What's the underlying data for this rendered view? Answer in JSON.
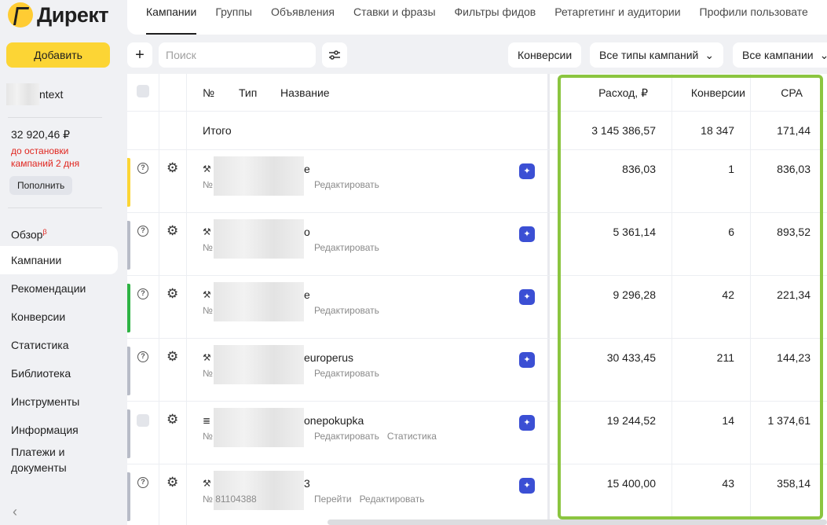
{
  "app": {
    "logo_text": "Директ"
  },
  "sidebar": {
    "add_label": "Добавить",
    "account_suffix": "ntext",
    "balance": "32 920,46 ₽",
    "warning": "до остановки кампаний 2 дня",
    "topup_label": "Пополнить",
    "items": [
      {
        "label": "Обзор",
        "sup": "β"
      },
      {
        "label": "Кампании"
      },
      {
        "label": "Рекомендации"
      },
      {
        "label": "Конверсии"
      },
      {
        "label": "Статистика"
      },
      {
        "label": "Библиотека"
      },
      {
        "label": "Инструменты"
      },
      {
        "label": "Информация"
      },
      {
        "label": "Платежи и документы"
      }
    ],
    "collapse_glyph": "‹"
  },
  "tabs": [
    "Кампании",
    "Группы",
    "Объявления",
    "Ставки и фразы",
    "Фильтры фидов",
    "Ретаргетинг и аудитории",
    "Профили пользовате"
  ],
  "toolbar": {
    "add_glyph": "+",
    "search_placeholder": "Поиск",
    "filter_conversions": "Конверсии",
    "filter_types": "Все типы кампаний",
    "filter_all": "Все кампании"
  },
  "table": {
    "headers": {
      "num": "№",
      "type": "Тип",
      "name": "Название",
      "spend": "Расход, ₽",
      "conversions": "Конверсии",
      "cpa": "CPA"
    },
    "total": {
      "label": "Итого",
      "spend": "3 145 386,57",
      "conversions": "18 347",
      "cpa": "171,44"
    },
    "rows": [
      {
        "status_color": "#fcd535",
        "name_suffix": "e",
        "sub_prefix": "№",
        "links": [
          "Редактировать"
        ],
        "spend": "836,03",
        "conversions": "1",
        "cpa": "836,03",
        "type_icon": "⚒",
        "lead_icon": "question-icon"
      },
      {
        "status_color": "#b8bcc7",
        "name_suffix": "o",
        "sub_prefix": "№",
        "links": [
          "Редактировать"
        ],
        "spend": "5 361,14",
        "conversions": "6",
        "cpa": "893,52",
        "type_icon": "⚒",
        "lead_icon": "question-icon"
      },
      {
        "status_color": "#2fb344",
        "name_suffix": "e",
        "sub_prefix": "№",
        "links": [
          "Редактировать"
        ],
        "spend": "9 296,28",
        "conversions": "42",
        "cpa": "221,34",
        "type_icon": "⚒",
        "lead_icon": "question-icon"
      },
      {
        "status_color": "#b8bcc7",
        "name_suffix": "europerus",
        "sub_prefix": "№",
        "links": [
          "Редактировать"
        ],
        "spend": "30 433,45",
        "conversions": "211",
        "cpa": "144,23",
        "type_icon": "⚒",
        "lead_icon": "question-icon"
      },
      {
        "status_color": "#b8bcc7",
        "name_suffix": "onepokupka",
        "sub_prefix": "№",
        "links": [
          "Редактировать",
          "Статистика"
        ],
        "spend": "19 244,52",
        "conversions": "14",
        "cpa": "1 374,61",
        "type_icon": "≣",
        "lead_icon": "checkbox"
      },
      {
        "status_color": "#b8bcc7",
        "name_suffix": "3",
        "sub_prefix": "№ 81104388",
        "links": [
          "Перейти",
          "Редактировать"
        ],
        "spend": "15 400,00",
        "conversions": "43",
        "cpa": "358,14",
        "type_icon": "⚒",
        "lead_icon": "question-icon"
      }
    ]
  },
  "colors": {
    "highlight": "#8bc540",
    "brand": "#fcd535",
    "ai_badge": "#3b4fd4"
  }
}
